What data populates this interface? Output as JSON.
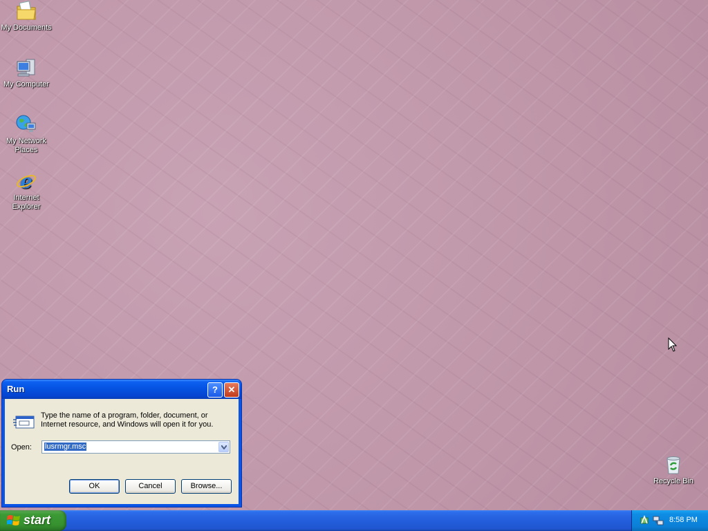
{
  "desktop": {
    "icons": [
      {
        "label": "My Documents"
      },
      {
        "label": "My Computer"
      },
      {
        "label": "My Network Places"
      },
      {
        "label": "Internet Explorer"
      },
      {
        "label": "Recycle Bin"
      }
    ]
  },
  "run_dialog": {
    "title": "Run",
    "help_glyph": "?",
    "close_glyph": "✕",
    "description": "Type the name of a program, folder, document, or Internet resource, and Windows will open it for you.",
    "open_label": "Open:",
    "open_value": "lusrmgr.msc",
    "ok_label": "OK",
    "cancel_label": "Cancel",
    "browse_label": "Browse..."
  },
  "taskbar": {
    "start_label": "start",
    "clock": "8:58 PM"
  },
  "colors": {
    "desktop_bg": "#c39cae",
    "titlebar_blue": "#0551e0",
    "start_green": "#3c9a35",
    "tray_blue": "#0b7fd6"
  }
}
